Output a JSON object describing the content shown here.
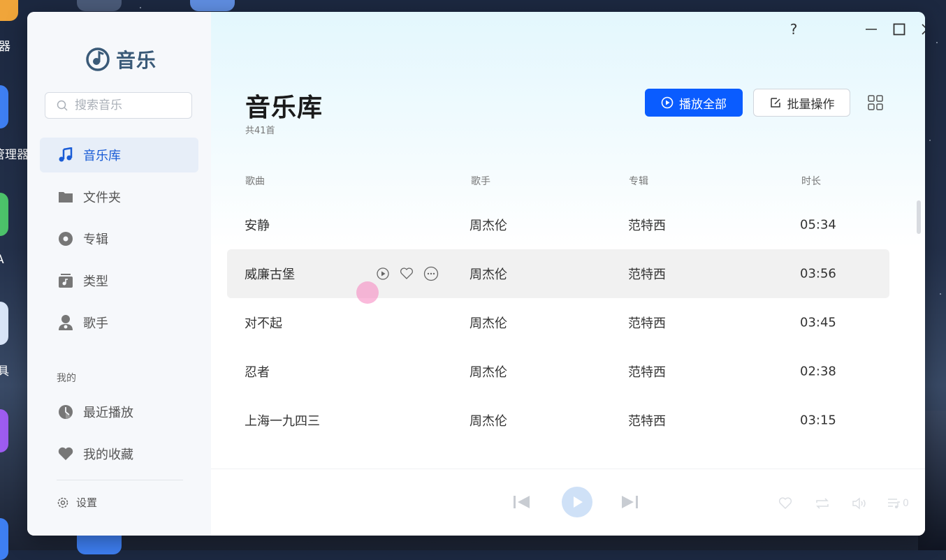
{
  "desktop": {
    "labels": [
      "器",
      "管理器",
      "A",
      "具"
    ]
  },
  "app": {
    "name": "音乐"
  },
  "search": {
    "placeholder": "搜索音乐"
  },
  "sidebar": {
    "items": [
      {
        "label": "音乐库",
        "icon": "music-note-icon",
        "active": true
      },
      {
        "label": "文件夹",
        "icon": "folder-icon",
        "active": false
      },
      {
        "label": "专辑",
        "icon": "album-disc-icon",
        "active": false
      },
      {
        "label": "类型",
        "icon": "genre-icon",
        "active": false
      },
      {
        "label": "歌手",
        "icon": "singer-icon",
        "active": false
      }
    ],
    "section_mine": "我的",
    "mine_items": [
      {
        "label": "最近播放",
        "icon": "clock-icon"
      },
      {
        "label": "我的收藏",
        "icon": "heart-icon"
      }
    ],
    "settings_label": "设置"
  },
  "header": {
    "title": "音乐库",
    "count": "共41首",
    "play_all_label": "播放全部",
    "batch_label": "批量操作"
  },
  "window_controls": {
    "help": "?"
  },
  "table": {
    "columns": [
      "歌曲",
      "歌手",
      "专辑",
      "时长"
    ],
    "rows": [
      {
        "song": "安静",
        "artist": "周杰伦",
        "album": "范特西",
        "duration": "05:34"
      },
      {
        "song": "威廉古堡",
        "artist": "周杰伦",
        "album": "范特西",
        "duration": "03:56"
      },
      {
        "song": "对不起",
        "artist": "周杰伦",
        "album": "范特西",
        "duration": "03:45"
      },
      {
        "song": "忍者",
        "artist": "周杰伦",
        "album": "范特西",
        "duration": "02:38"
      },
      {
        "song": "上海一九四三",
        "artist": "周杰伦",
        "album": "范特西",
        "duration": "03:15"
      }
    ],
    "hovered_row": 1
  },
  "player": {
    "queue_count": "0"
  },
  "colors": {
    "accent": "#0a5cff",
    "active_nav_bg": "#e7eef8",
    "logo": "#3a5a78"
  }
}
